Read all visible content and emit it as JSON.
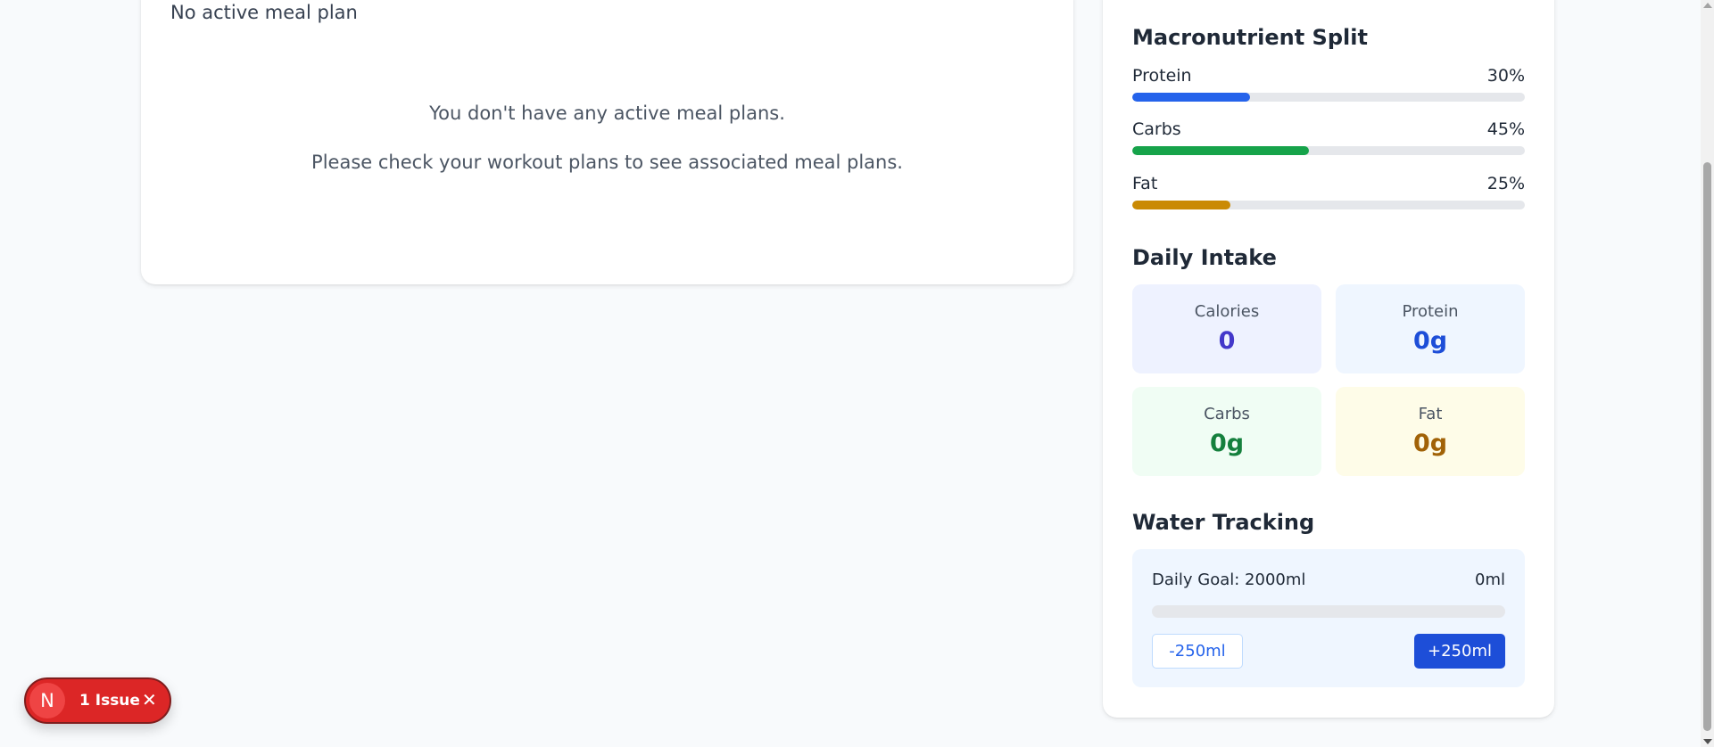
{
  "meal_plan": {
    "title": "No active meal plan",
    "empty_line_1": "You don't have any active meal plans.",
    "empty_line_2": "Please check your workout plans to see associated meal plans."
  },
  "macro_split": {
    "title": "Macronutrient Split",
    "items": [
      {
        "label": "Protein",
        "percent_text": "30%",
        "percent": 30,
        "color": "#2563eb"
      },
      {
        "label": "Carbs",
        "percent_text": "45%",
        "percent": 45,
        "color": "#16a34a"
      },
      {
        "label": "Fat",
        "percent_text": "25%",
        "percent": 25,
        "color": "#ca8a04"
      }
    ]
  },
  "daily_intake": {
    "title": "Daily Intake",
    "stats": [
      {
        "label": "Calories",
        "value": "0",
        "bg": "#eef2ff",
        "color": "#4338ca"
      },
      {
        "label": "Protein",
        "value": "0g",
        "bg": "#eff6ff",
        "color": "#1d4ed8"
      },
      {
        "label": "Carbs",
        "value": "0g",
        "bg": "#f0fdf4",
        "color": "#15803d"
      },
      {
        "label": "Fat",
        "value": "0g",
        "bg": "#fefce8",
        "color": "#a16207"
      }
    ]
  },
  "water": {
    "title": "Water Tracking",
    "goal_label": "Daily Goal: 2000ml",
    "current": "0ml",
    "progress": 0,
    "minus_label": "-250ml",
    "plus_label": "+250ml"
  },
  "issue_badge": {
    "avatar_letter": "N",
    "label": "1 Issue",
    "close_glyph": "✕"
  }
}
